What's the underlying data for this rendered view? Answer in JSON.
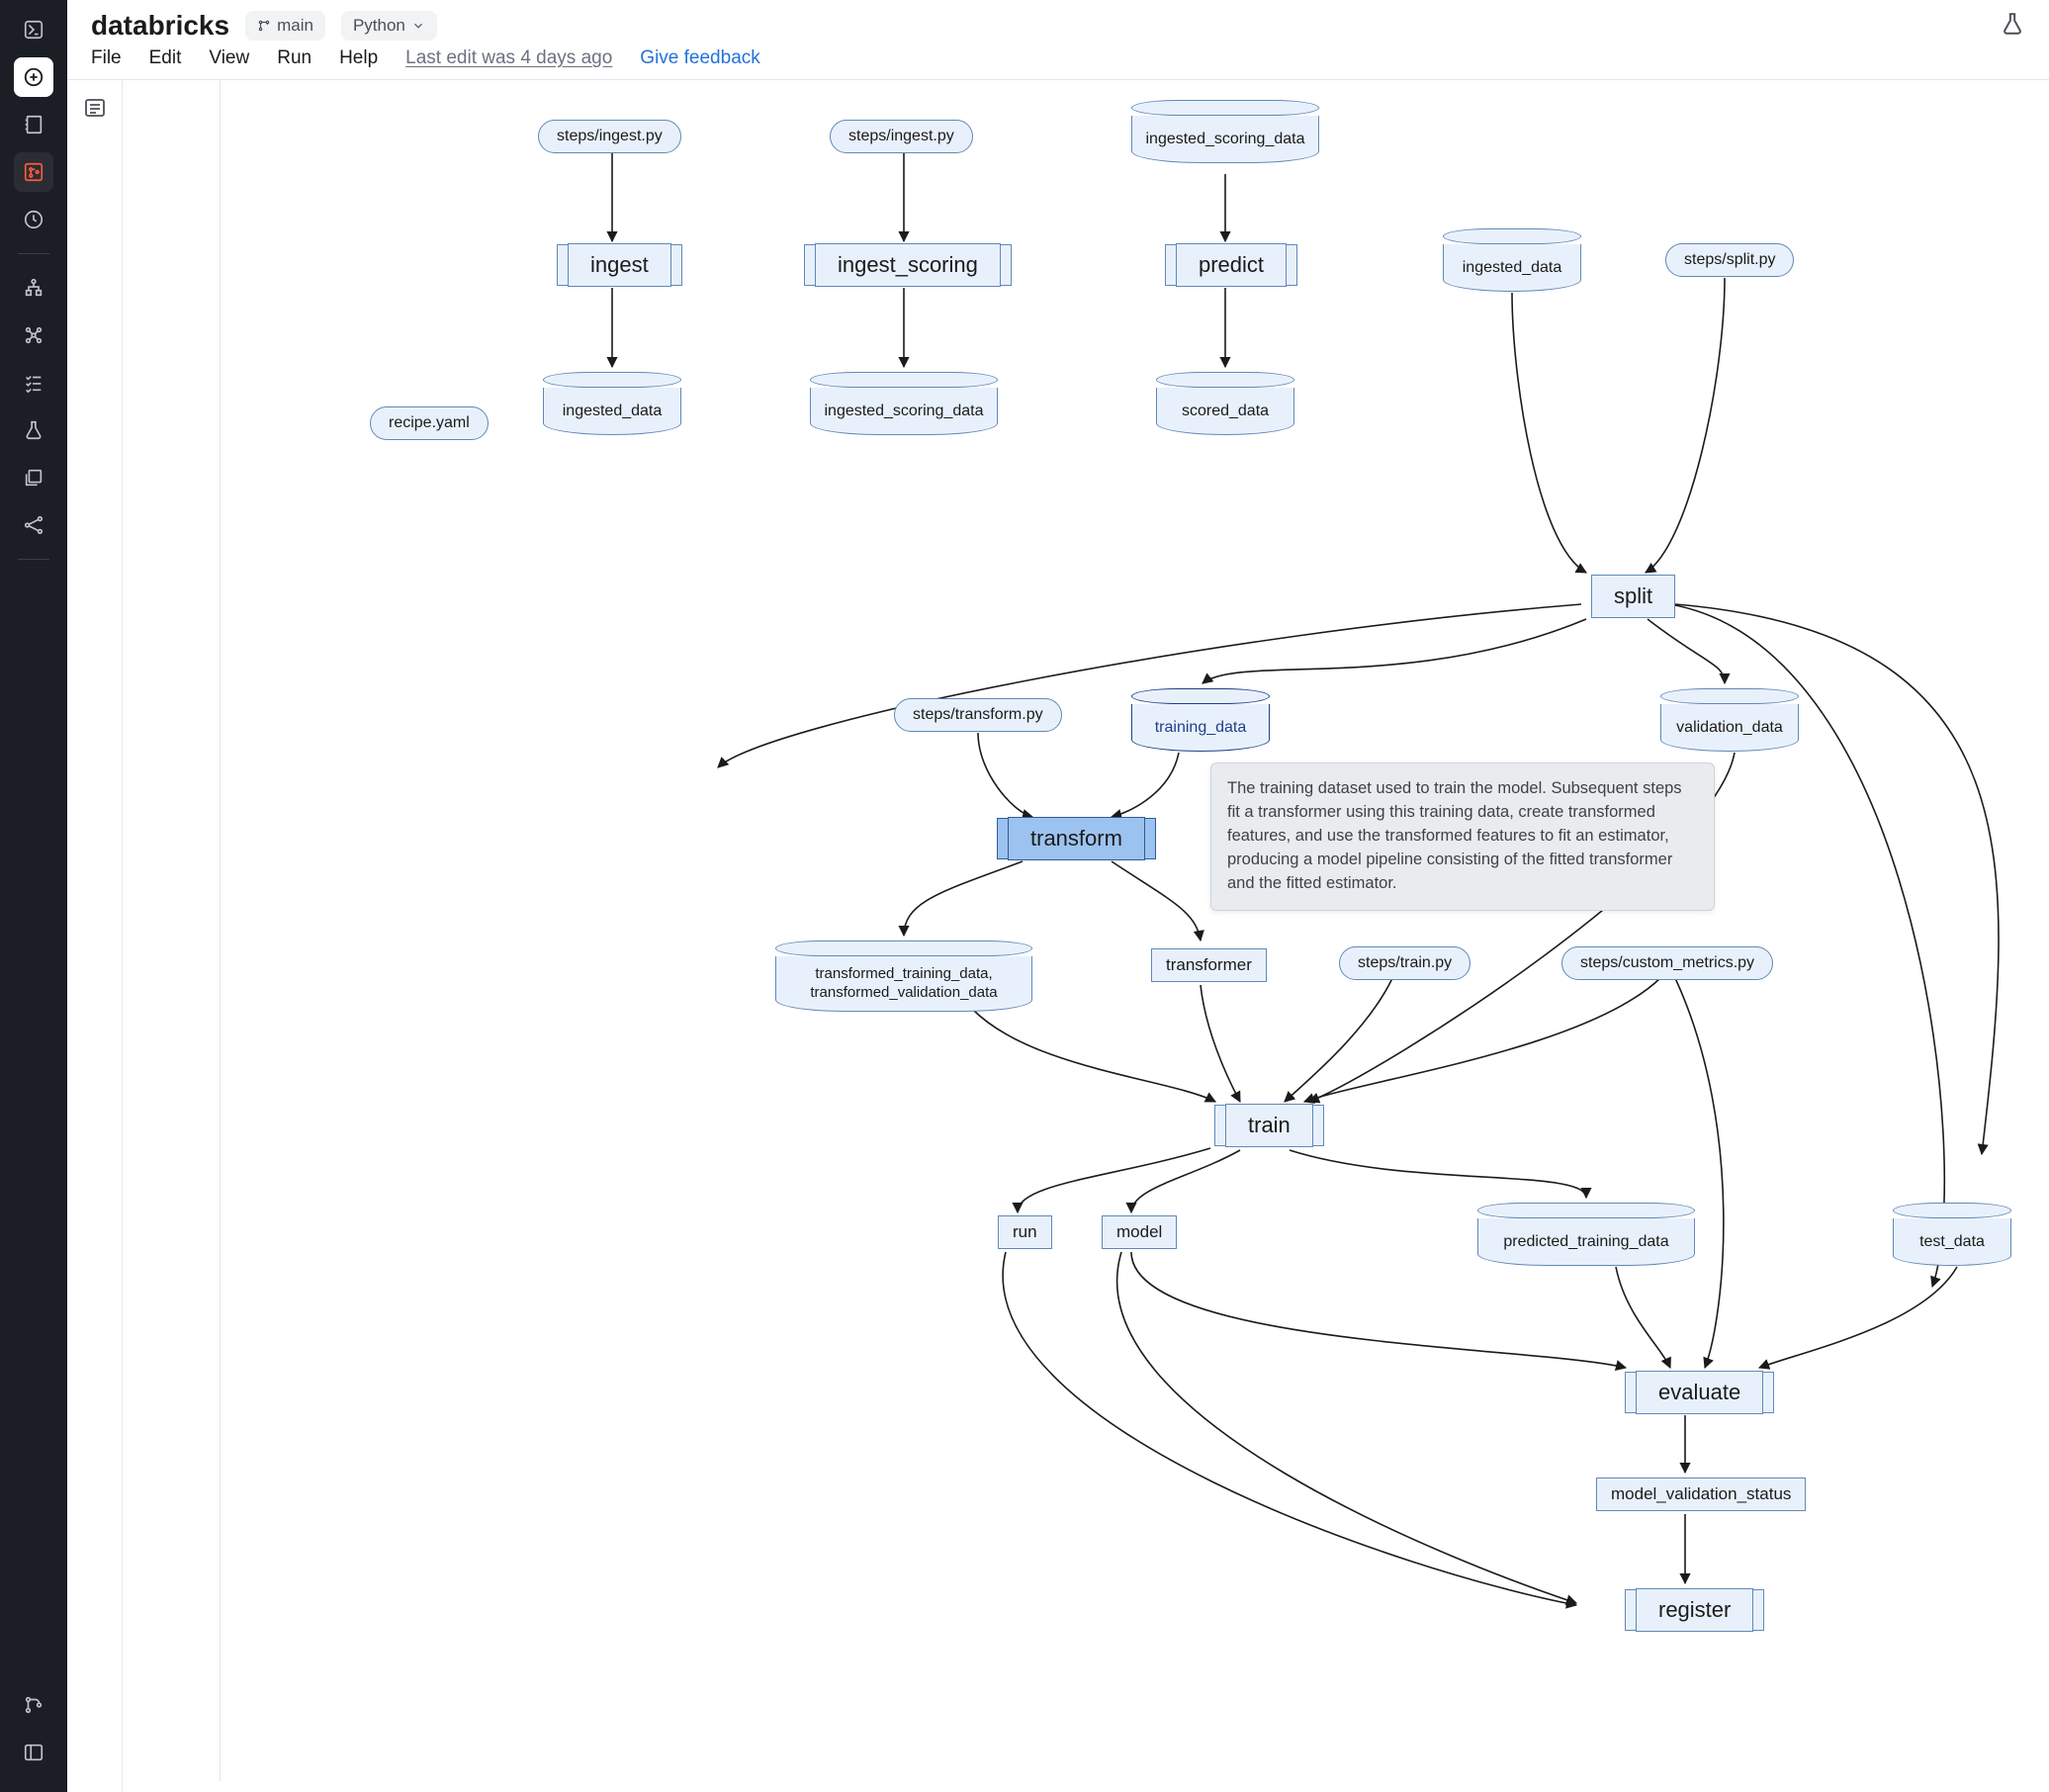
{
  "header": {
    "title": "databricks",
    "branch_label": "main",
    "lang_label": "Python",
    "menu": {
      "file": "File",
      "edit": "Edit",
      "view": "View",
      "run": "Run",
      "help": "Help"
    },
    "last_edit": "Last edit was 4 days ago",
    "feedback": "Give feedback"
  },
  "rail_icons": [
    "logo",
    "plus",
    "notebook",
    "repo",
    "recent",
    "tree",
    "model",
    "tasks",
    "flask",
    "stack",
    "graph"
  ],
  "rail_bottom_icons": [
    "branches",
    "panel"
  ],
  "graph": {
    "nodes": {
      "recipe_yaml": {
        "label": "recipe.yaml"
      },
      "ingest_src": {
        "label": "steps/ingest.py"
      },
      "ingest_scoring_src": {
        "label": "steps/ingest.py"
      },
      "ingested_scoring_cyl_top": {
        "label": "ingested_scoring_data"
      },
      "ingest_step": {
        "label": "ingest"
      },
      "ingest_scoring_step": {
        "label": "ingest_scoring"
      },
      "predict_step": {
        "label": "predict"
      },
      "ingested_data_cyl": {
        "label": "ingested_data"
      },
      "ingested_scoring_cyl": {
        "label": "ingested_scoring_data"
      },
      "scored_data_cyl": {
        "label": "scored_data"
      },
      "ingested_data_cyl_2": {
        "label": "ingested_data"
      },
      "split_src": {
        "label": "steps/split.py"
      },
      "split_step": {
        "label": "split"
      },
      "transform_src": {
        "label": "steps/transform.py"
      },
      "training_data_cyl": {
        "label": "training_data"
      },
      "validation_data_cyl": {
        "label": "validation_data"
      },
      "transform_step": {
        "label": "transform"
      },
      "transformed_cyl": {
        "label": "transformed_training_data,\ntransformed_validation_data"
      },
      "transformer": {
        "label": "transformer"
      },
      "train_src": {
        "label": "steps/train.py"
      },
      "custom_metrics_src": {
        "label": "steps/custom_metrics.py"
      },
      "train_step": {
        "label": "train"
      },
      "run": {
        "label": "run"
      },
      "model": {
        "label": "model"
      },
      "predicted_training_cyl": {
        "label": "predicted_training_data"
      },
      "test_data_cyl": {
        "label": "test_data"
      },
      "evaluate_step": {
        "label": "evaluate"
      },
      "model_val_status": {
        "label": "model_validation_status"
      },
      "register_step": {
        "label": "register"
      }
    },
    "tooltip": "The training dataset used to train the model. Subsequent steps fit a transformer using this training data, create transformed features, and use the transformed features to fit an estimator, producing a model pipeline consisting of the fitted transformer and the fitted estimator."
  }
}
